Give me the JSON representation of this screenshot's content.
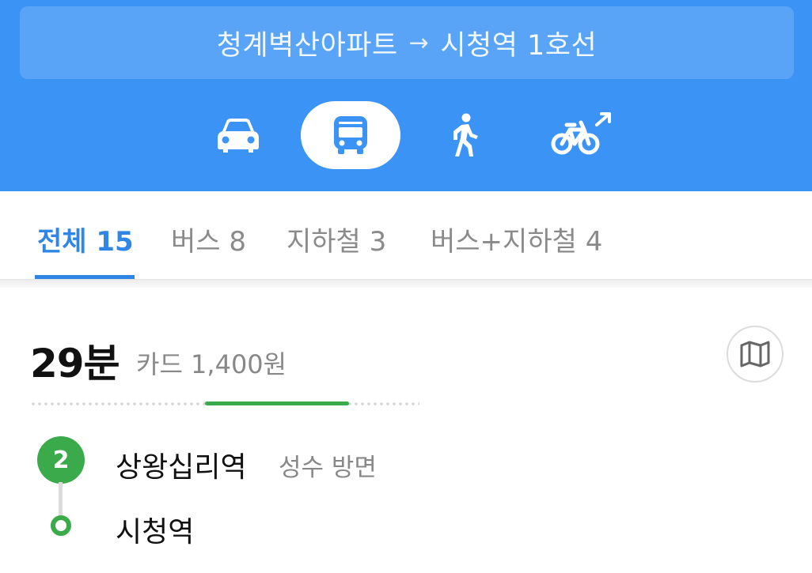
{
  "header": {
    "origin": "청계벽산아파트",
    "arrow": "→",
    "destination": "시청역 1호선",
    "modes": [
      {
        "name": "car",
        "icon": "car-icon",
        "selected": false
      },
      {
        "name": "bus",
        "icon": "bus-icon",
        "selected": true
      },
      {
        "name": "walk",
        "icon": "walk-icon",
        "selected": false
      },
      {
        "name": "bike",
        "icon": "bike-external-icon",
        "selected": false
      }
    ]
  },
  "tabs": [
    {
      "label": "전체 15",
      "active": true
    },
    {
      "label": "버스 8",
      "active": false
    },
    {
      "label": "지하철 3",
      "active": false
    },
    {
      "label": "버스+지하철 4",
      "active": false
    }
  ],
  "result": {
    "time": "29분",
    "fare": "카드 1,400원",
    "map_icon": "map-icon",
    "line_badge": "2",
    "line_color": "#3aaa4a",
    "progress": {
      "segment_start": 0.45,
      "segment_end": 0.82
    },
    "start_station": "상왕십리역",
    "direction": "성수 방면",
    "end_station": "시청역"
  },
  "colors": {
    "header_bg": "#3a93f5",
    "active_tab": "#2f86e6",
    "line2_green": "#3aaa4a"
  }
}
